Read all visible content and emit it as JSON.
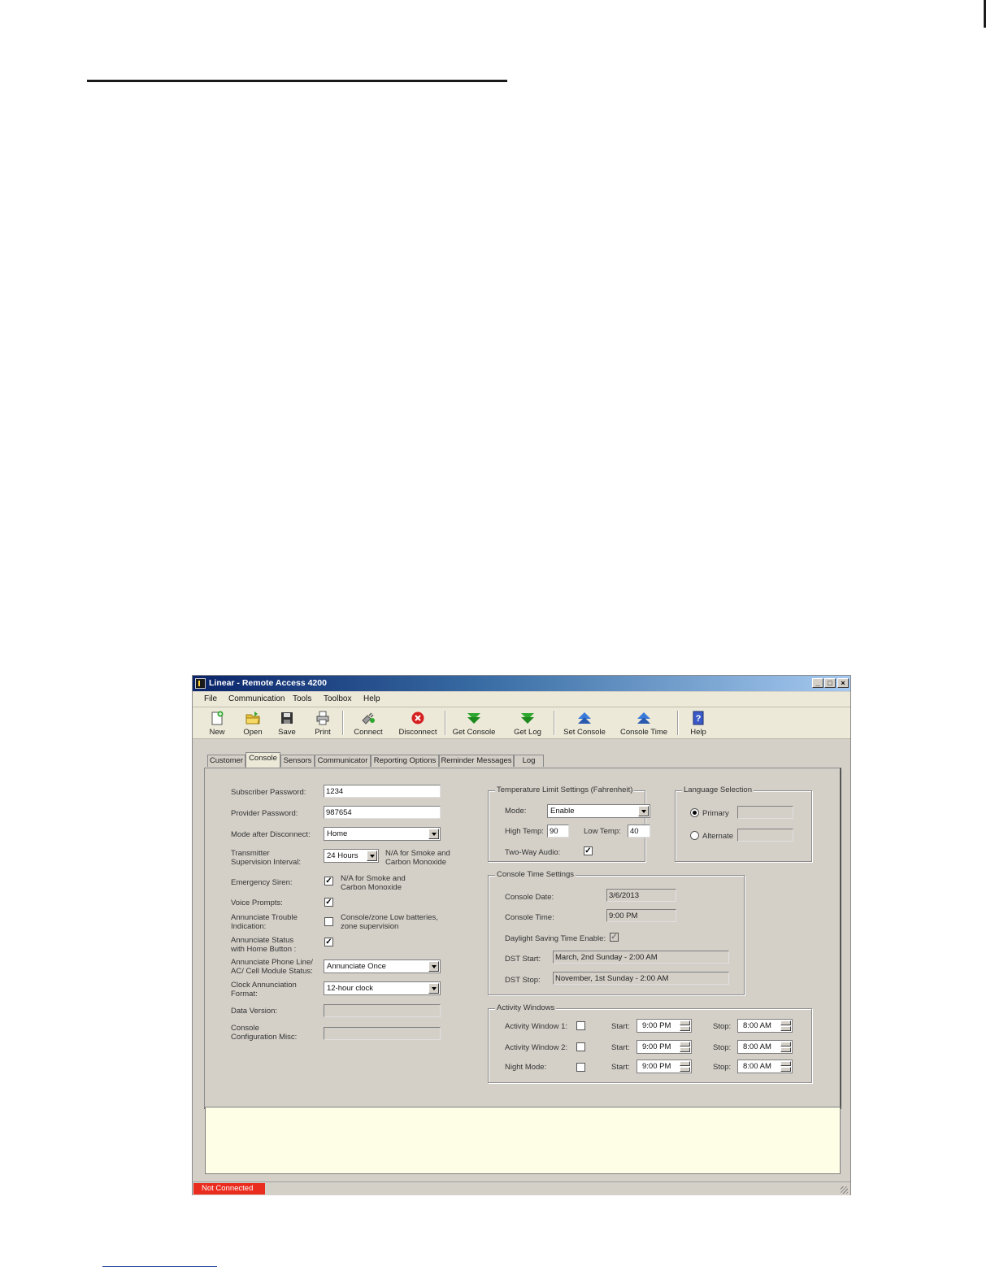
{
  "window": {
    "title": "Linear - Remote Access 4200"
  },
  "menu": [
    "File",
    "Communication",
    "Tools",
    "Toolbox",
    "Help"
  ],
  "toolbar": {
    "new": "New",
    "open": "Open",
    "save": "Save",
    "print": "Print",
    "connect": "Connect",
    "disconnect": "Disconnect",
    "get_console": "Get Console",
    "get_log": "Get Log",
    "set_console": "Set Console",
    "console_time": "Console Time",
    "help": "Help"
  },
  "tabs": [
    "Customer",
    "Console",
    "Sensors",
    "Communicator",
    "Reporting Options",
    "Reminder Messages",
    "Log"
  ],
  "console": {
    "subscriber_password_label": "Subscriber Password:",
    "subscriber_password": "1234",
    "provider_password_label": "Provider Password:",
    "provider_password": "987654",
    "mode_after_disconnect_label": "Mode after Disconnect:",
    "mode_after_disconnect": "Home",
    "transmitter_label_1": "Transmitter",
    "transmitter_label_2": "Supervision Interval:",
    "transmitter_interval": "24 Hours",
    "transmitter_note_1": "N/A for Smoke and",
    "transmitter_note_2": "Carbon Monoxide",
    "emergency_siren_label": "Emergency Siren:",
    "emergency_note_1": "N/A for Smoke and",
    "emergency_note_2": "Carbon Monoxide",
    "voice_prompts_label": "Voice Prompts:",
    "annunciate_trouble_label_1": "Annunciate Trouble",
    "annunciate_trouble_label_2": "Indication:",
    "annunciate_trouble_note_1": "Console/zone Low batteries,",
    "annunciate_trouble_note_2": "zone supervision",
    "annunciate_status_label_1": "Annunciate Status",
    "annunciate_status_label_2": "with Home Button :",
    "annunciate_phone_label_1": "Annunciate Phone Line/",
    "annunciate_phone_label_2": "AC/ Cell Module Status:",
    "annunciate_phone": "Annunciate Once",
    "clock_label_1": "Clock Annunciation",
    "clock_label_2": "Format:",
    "clock_format": "12-hour clock",
    "data_version_label": "Data Version:",
    "console_config_label_1": "Console",
    "console_config_label_2": "Configuration Misc:",
    "check": "✓"
  },
  "temperature": {
    "title": "Temperature Limit Settings (Fahrenheit)",
    "mode_label": "Mode:",
    "mode": "Enable",
    "high_label": "High Temp:",
    "high": "90",
    "low_label": "Low Temp:",
    "low": "40",
    "two_way_label": "Two-Way Audio:"
  },
  "language": {
    "title": "Language Selection",
    "primary": "Primary",
    "alternate": "Alternate"
  },
  "console_time": {
    "title": "Console Time Settings",
    "date_label": "Console Date:",
    "date": "3/6/2013",
    "time_label": "Console Time:",
    "time": "9:00 PM",
    "dst_enable_label": "Daylight Saving Time Enable:",
    "dst_start_label": "DST Start:",
    "dst_start": "March, 2nd Sunday - 2:00 AM",
    "dst_stop_label": "DST Stop:",
    "dst_stop": "November, 1st Sunday - 2:00 AM"
  },
  "activity": {
    "title": "Activity Windows",
    "start_label": "Start:",
    "stop_label": "Stop:",
    "rows": [
      {
        "label": "Activity Window 1:",
        "start": "9:00 PM",
        "stop": "8:00 AM"
      },
      {
        "label": "Activity Window 2:",
        "start": "9:00 PM",
        "stop": "8:00 AM"
      },
      {
        "label": "Night Mode:",
        "start": "9:00 PM",
        "stop": "8:00 AM"
      }
    ]
  },
  "status": {
    "connection": "Not Connected"
  },
  "colors": {
    "status_red": "#ea2c1e",
    "title_blue": "#0a246a",
    "message_bg": "#fefee6"
  }
}
